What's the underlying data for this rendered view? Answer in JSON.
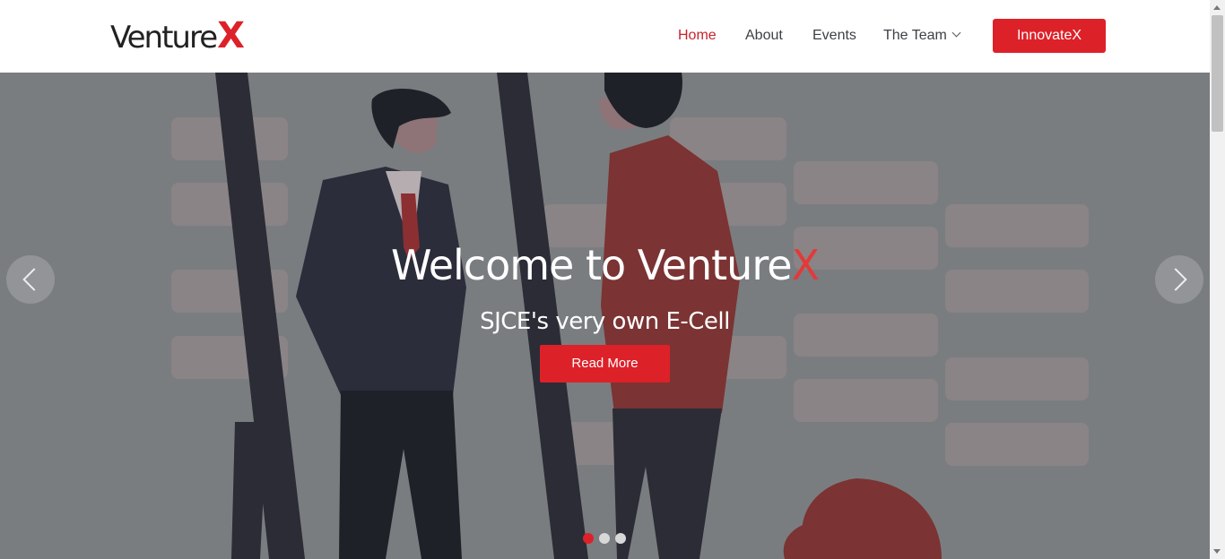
{
  "brand": {
    "name": "Venture",
    "mark": "X"
  },
  "nav": {
    "items": [
      {
        "label": "Home",
        "active": true
      },
      {
        "label": "About"
      },
      {
        "label": "Events"
      },
      {
        "label": "The Team",
        "dropdown": true
      }
    ],
    "cta_label": "InnovateX"
  },
  "hero": {
    "title": "Welcome to Venture",
    "title_mark": "X",
    "subtitle": "SJCE's very own E-Cell",
    "button_label": "Read More",
    "slides": 3,
    "active_slide": 1
  },
  "colors": {
    "accent": "#dd2129",
    "nav_text": "#3b4145",
    "overlay": "#7a7d80"
  },
  "icons": {
    "prev": "chevron-left-icon",
    "next": "chevron-right-icon",
    "dropdown": "chevron-down-icon"
  }
}
